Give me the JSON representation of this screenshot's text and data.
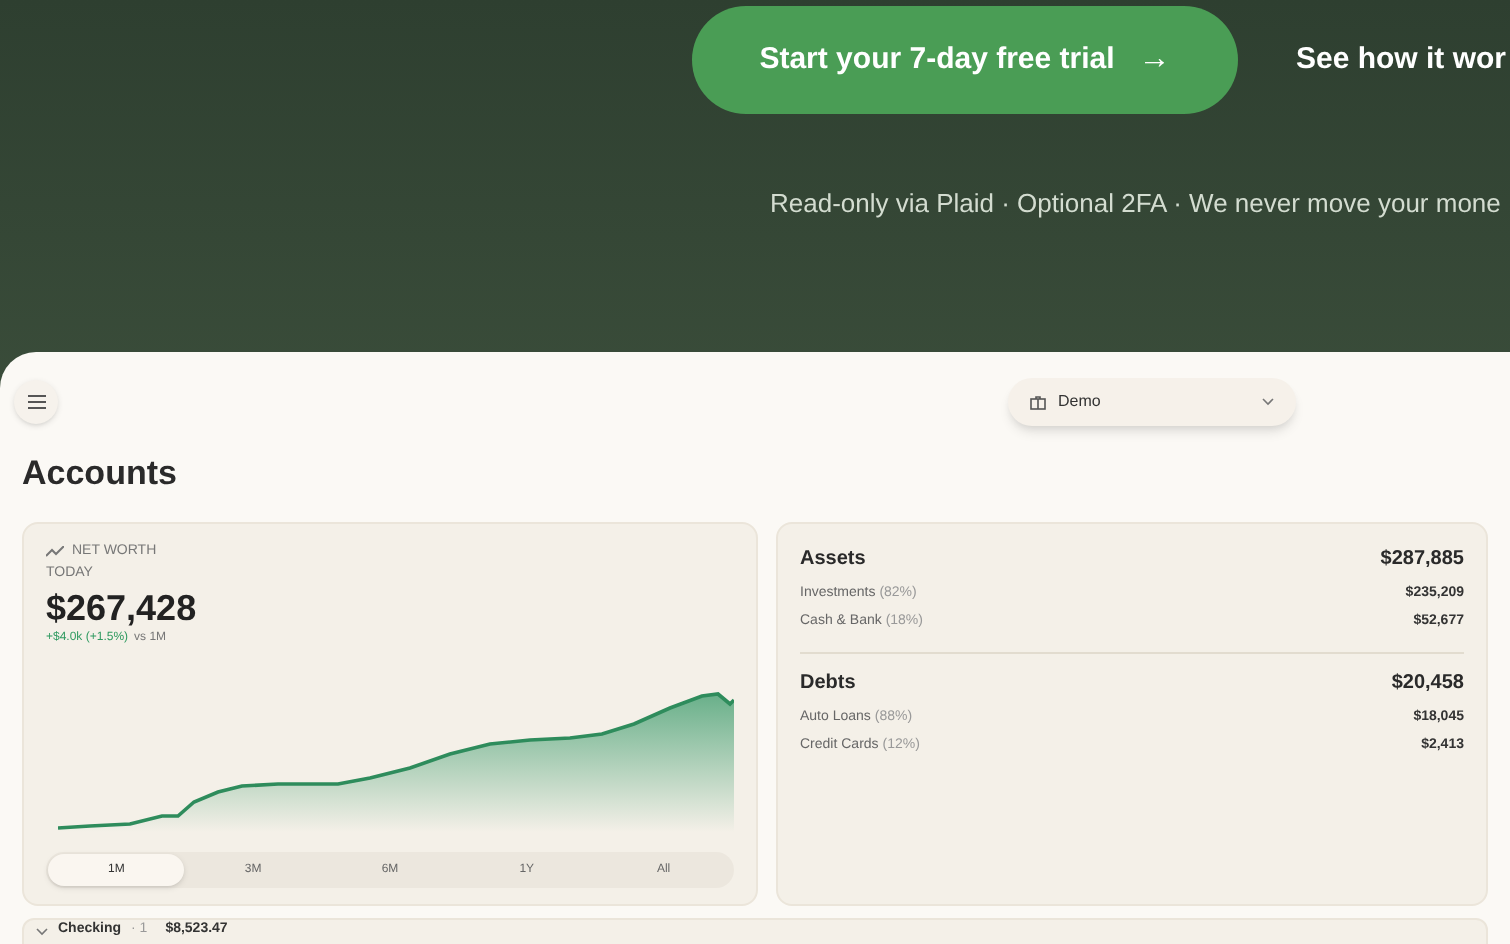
{
  "hero": {
    "primary_button": {
      "label": "Start your 7-day free trial",
      "icon": "→"
    },
    "secondary_link": "See how it wor",
    "note": "Read-only via Plaid · Optional 2FA · We never move your mone"
  },
  "app": {
    "workspace": "Demo",
    "title": "Accounts",
    "net_worth": {
      "label": "NET WORTH",
      "period": "TODAY",
      "value": "$267,428",
      "change": "+$4.0k (+1.5%)",
      "comparison": "vs 1M",
      "ranges": [
        {
          "label": "1M",
          "selected": true
        },
        {
          "label": "3M",
          "selected": false
        },
        {
          "label": "6M",
          "selected": false
        },
        {
          "label": "1Y",
          "selected": false
        },
        {
          "label": "All",
          "selected": false
        }
      ]
    },
    "groups": [
      {
        "name": "Assets",
        "total": "$287,885",
        "rows": [
          {
            "label": "Investments",
            "share": "(82%)",
            "value": "$235,209"
          },
          {
            "label": "Cash & Bank",
            "share": "(18%)",
            "value": "$52,677"
          }
        ]
      },
      {
        "name": "Debts",
        "total": "$20,458",
        "rows": [
          {
            "label": "Auto Loans",
            "share": "(88%)",
            "value": "$18,045"
          },
          {
            "label": "Credit Cards",
            "share": "(12%)",
            "value": "$2,413"
          }
        ]
      }
    ],
    "sections": [
      {
        "name": "Checking",
        "count": "· 1",
        "total": "$8,523.47",
        "expanded": true
      }
    ]
  }
}
